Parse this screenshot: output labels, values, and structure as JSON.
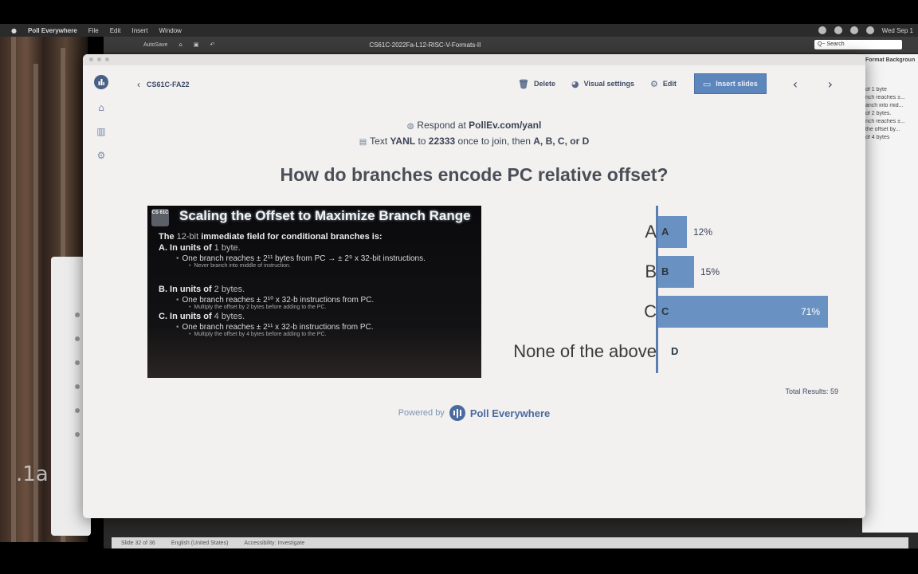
{
  "menubar": {
    "app_name": "Poll Everywhere",
    "items": [
      "File",
      "Edit",
      "Insert",
      "Window"
    ],
    "datetime": "Wed Sep 1"
  },
  "ppt": {
    "title": "CS61C-2022Fa-L12-RISC-V-Formats-II",
    "autosave": "AutoSave",
    "search_placeholder": "Q~ Search",
    "side_items": [
      "Format Background",
      "of 1 byte",
      "nch reaches ±...",
      "anch into mid...",
      "of 2 bytes.",
      "nch reaches ±...",
      "the offset by...",
      "of 4 bytes"
    ],
    "status_items": [
      "Slide 32 of 36",
      "English (United States)",
      "Accessibility: Investigate"
    ]
  },
  "breadcrumb": {
    "label": "CS61C-FA22"
  },
  "toolbar": {
    "delete": "Delete",
    "visual_settings": "Visual settings",
    "edit": "Edit",
    "insert_slides": "Insert slides"
  },
  "respond": {
    "prefix": "Respond at",
    "url": "PollEv.com/yanl",
    "text_prefix": "Text",
    "keyword": "YANL",
    "to": "to",
    "number": "22333",
    "suffix": "once to join, then",
    "options": "A, B, C, or D"
  },
  "question": "How do branches encode PC relative offset?",
  "slide": {
    "logo": "CS 61C",
    "title": "Scaling the Offset to Maximize Branch Range",
    "intro_a": "The",
    "intro_b": "12-bit",
    "intro_c": "immediate field for conditional branches is:",
    "a_head": "A.  In units of",
    "a_unit": "1 byte.",
    "a_1": "One branch reaches ± 2¹¹ bytes from PC → ± 2⁹ x 32-bit instructions.",
    "a_2": "Never branch into middle of instruction.",
    "b_head": "B.  In units of",
    "b_unit": "2 bytes.",
    "b_1": "One branch reaches ± 2¹⁰ x 32-b instructions from PC.",
    "b_2": "Multiply the offset by 2 bytes before adding to the PC.",
    "c_head": "C.  In units of",
    "c_unit": "4 bytes.",
    "c_1": "One branch reaches ± 2¹¹ x 32-b instructions from PC.",
    "c_2": "Multiply the offset by 4 bytes before adding to the PC."
  },
  "chart_data": {
    "type": "bar",
    "orientation": "horizontal",
    "categories": [
      "A",
      "B",
      "C",
      "None of the above"
    ],
    "letters": [
      "A",
      "B",
      "C",
      "D"
    ],
    "values": [
      12,
      15,
      71,
      0
    ],
    "value_labels": [
      "12%",
      "15%",
      "71%",
      ""
    ],
    "xlim": [
      0,
      100
    ],
    "unit": "%",
    "bar_color": "#6992c3"
  },
  "total": "Total Results: 59",
  "powered": {
    "text": "Powered by",
    "brand": "Poll Everywhere"
  }
}
